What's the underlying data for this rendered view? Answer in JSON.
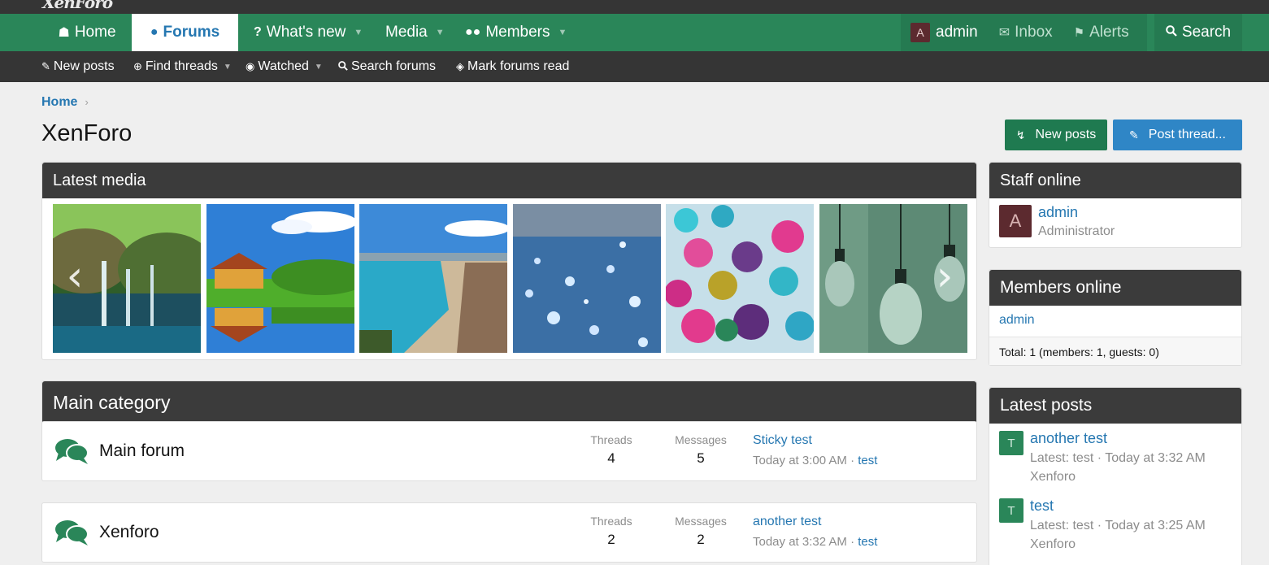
{
  "logo_text": "XenForo",
  "colors": {
    "accent_green": "#2a8659",
    "link_blue": "#2577b1",
    "header_dark": "#353535",
    "block_head": "#3b3b3b",
    "avatar_red": "#5c2a2f"
  },
  "nav": {
    "home": {
      "label": "Home",
      "icon": "home-icon"
    },
    "forums": {
      "label": "Forums",
      "icon": "chat-bubble-icon"
    },
    "whats_new": {
      "label": "What's new",
      "icon": "question-icon"
    },
    "media": {
      "label": "Media"
    },
    "members": {
      "label": "Members",
      "icon": "users-icon"
    },
    "user": {
      "avatar_letter": "A",
      "name": "admin"
    },
    "inbox": {
      "label": "Inbox",
      "icon": "envelope-icon"
    },
    "alerts": {
      "label": "Alerts",
      "icon": "bell-icon"
    },
    "search": {
      "label": "Search",
      "icon": "search-icon"
    }
  },
  "subnav": {
    "new_posts": "New posts",
    "find_threads": "Find threads",
    "watched": "Watched",
    "search_forums": "Search forums",
    "mark_read": "Mark forums read"
  },
  "breadcrumb": {
    "home": "Home",
    "sep": "›"
  },
  "page_title": "XenForo",
  "actions": {
    "new_posts": "New posts",
    "post_thread": "Post thread..."
  },
  "latest_media": {
    "title": "Latest media",
    "thumbs": [
      "waterfall",
      "house-lake",
      "beach-coast",
      "water-drops",
      "glass-marbles",
      "light-bulbs"
    ]
  },
  "main_category": {
    "title": "Main category",
    "forums": [
      {
        "name": "Main forum",
        "threads_label": "Threads",
        "threads": "4",
        "messages_label": "Messages",
        "messages": "5",
        "last_title": "Sticky test",
        "last_time": "Today at 3:00 AM · ",
        "last_user": "test"
      },
      {
        "name": "Xenforo",
        "threads_label": "Threads",
        "threads": "2",
        "messages_label": "Messages",
        "messages": "2",
        "last_title": "another test",
        "last_time": "Today at 3:32 AM · ",
        "last_user": "test"
      }
    ]
  },
  "staff_online": {
    "title": "Staff online",
    "avatar_letter": "A",
    "name": "admin",
    "role": "Administrator"
  },
  "members_online": {
    "title": "Members online",
    "member": "admin",
    "total": "Total: 1 (members: 1, guests: 0)"
  },
  "latest_posts": {
    "title": "Latest posts",
    "items": [
      {
        "avatar": "T",
        "title": "another test",
        "meta": "Latest: test · Today at 3:32 AM",
        "forum": "Xenforo"
      },
      {
        "avatar": "T",
        "title": "test",
        "meta": "Latest: test · Today at 3:25 AM",
        "forum": "Xenforo"
      }
    ]
  }
}
